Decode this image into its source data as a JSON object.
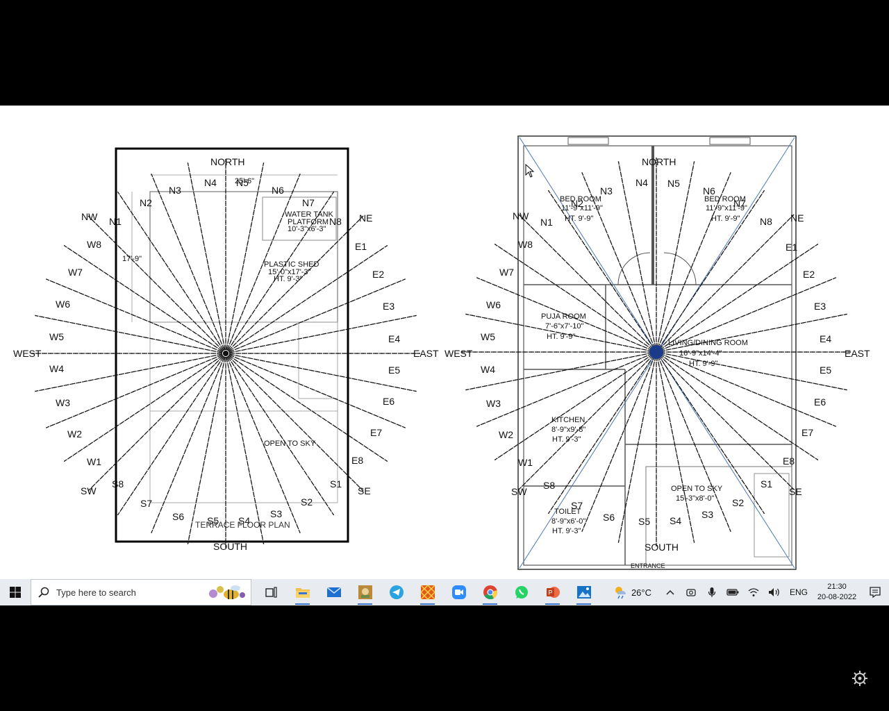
{
  "plans": {
    "terrace": {
      "title": "TERRACE FLOOR PLAN",
      "north": "NORTH",
      "south": "SOUTH",
      "east": "EAST",
      "west": "WEST",
      "nw": "NW",
      "ne": "NE",
      "sw": "SW",
      "se": "SE",
      "n": [
        "N1",
        "N2",
        "N3",
        "N4",
        "N5",
        "N6",
        "N7",
        "N8"
      ],
      "e": [
        "E1",
        "E2",
        "E3",
        "E4",
        "E5",
        "E6",
        "E7",
        "E8"
      ],
      "s": [
        "S1",
        "S2",
        "S3",
        "S4",
        "S5",
        "S6",
        "S7",
        "S8"
      ],
      "w": [
        "W1",
        "W2",
        "W3",
        "W4",
        "W5",
        "W6",
        "W7",
        "W8"
      ],
      "water_tank": "WATER TANK",
      "platform": "PLATFORM",
      "tank_dims": "10'-3\"x6'-3\"",
      "plastic_shed": "PLASTIC SHED",
      "shed_dims": "15'-0\"x17'-3\"",
      "shed_ht": "HT. 9'-3\"",
      "open_to_sky": "OPEN TO SKY",
      "dim_width": "25'-6\"",
      "dim_height": "17'-9\""
    },
    "ground": {
      "north": "NORTH",
      "south": "SOUTH",
      "east": "EAST",
      "west": "WEST",
      "nw": "NW",
      "ne": "NE",
      "sw": "SW",
      "se": "SE",
      "n": [
        "N1",
        "N2",
        "N3",
        "N4",
        "N5",
        "N6",
        "N7",
        "N8"
      ],
      "e": [
        "E1",
        "E2",
        "E3",
        "E4",
        "E5",
        "E6",
        "E7",
        "E8"
      ],
      "s": [
        "S1",
        "S2",
        "S3",
        "S4",
        "S5",
        "S6",
        "S7",
        "S8"
      ],
      "w": [
        "W1",
        "W2",
        "W3",
        "W4",
        "W5",
        "W6",
        "W7",
        "W8"
      ],
      "bed1": "BED ROOM",
      "bed1_dims": "11'-9\"x11'-9\"",
      "bed1_ht": "HT. 9'-9\"",
      "bed2": "BED ROOM",
      "bed2_dims": "11'-9\"x11'-9\"",
      "bed2_ht": "HT. 9'-9\"",
      "puja": "PUJA ROOM",
      "puja_dims": "7'-6\"x7'-10\"",
      "puja_ht": "HT. 9'-9\"",
      "living": "LIVING/DINING ROOM",
      "living_dims": "16'-9\"x14'-4\"",
      "living_ht": "HT. 9'-9\"",
      "kitchen": "KITCHEN",
      "kitchen_dims": "8'-9\"x9'-8\"",
      "kitchen_ht": "HT. 9'-3\"",
      "toilet": "TOILET",
      "toilet_dims": "8'-9\"x6'-0\"",
      "toilet_ht": "HT. 9'-3\"",
      "open_sky": "OPEN TO SKY",
      "open_sky_dims": "15'-3\"x8'-0\"",
      "entrance": "ENTRANCE"
    }
  },
  "taskbar": {
    "search_placeholder": "Type here to search",
    "apps": [
      "task-view",
      "file-explorer",
      "mail",
      "photo-app",
      "telegram",
      "pattern-app",
      "zoom",
      "chrome",
      "whatsapp",
      "powerpoint",
      "photos"
    ],
    "weather_temp": "26°C",
    "language": "ENG",
    "time": "21:30",
    "date": "20-08-2022"
  },
  "colors": {
    "taskbar_bg": "#e8ecf0",
    "accent": "#3a76d0",
    "slide_bg": "#ffffff"
  }
}
